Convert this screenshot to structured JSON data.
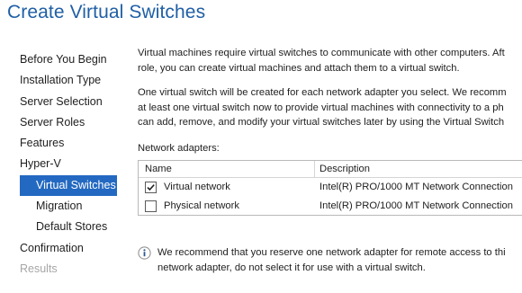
{
  "page": {
    "title": "Create Virtual Switches"
  },
  "nav": {
    "items": [
      {
        "label": "Before You Begin"
      },
      {
        "label": "Installation Type"
      },
      {
        "label": "Server Selection"
      },
      {
        "label": "Server Roles"
      },
      {
        "label": "Features"
      },
      {
        "label": "Hyper-V"
      },
      {
        "label": "Virtual Switches"
      },
      {
        "label": "Migration"
      },
      {
        "label": "Default Stores"
      },
      {
        "label": "Confirmation"
      },
      {
        "label": "Results"
      }
    ],
    "selected_item": "Virtual Switches",
    "disabled_item": "Results"
  },
  "content": {
    "intro_lines": [
      "Virtual machines require virtual switches to communicate with other computers. Aft",
      "role, you can create virtual machines and attach them to a virtual switch."
    ],
    "detail_lines": [
      "One virtual switch will be created for each network adapter you select. We recomm",
      "at least one virtual switch now to provide virtual machines with connectivity to a ph",
      "can add, remove, and modify your virtual switches later by using the Virtual Switch"
    ],
    "adapters_label": "Network adapters:",
    "adapters_table": {
      "columns": [
        "Name",
        "Description"
      ],
      "rows": [
        {
          "checked": true,
          "name": "Virtual network",
          "description": "Intel(R) PRO/1000 MT Network Connection"
        },
        {
          "checked": false,
          "name": "Physical network",
          "description": "Intel(R) PRO/1000 MT Network Connection"
        }
      ]
    },
    "info_lines": [
      "We recommend that you reserve one network adapter for remote access to thi",
      "network adapter, do not select it for use with a virtual switch."
    ]
  },
  "colors": {
    "title": "#1f5fa5",
    "selected_background": "#2369c1",
    "disabled_text": "#a6a6a6",
    "info_icon": "#2b5797"
  },
  "icons": {
    "checkbox_check": "check-icon",
    "info": "info-icon"
  }
}
